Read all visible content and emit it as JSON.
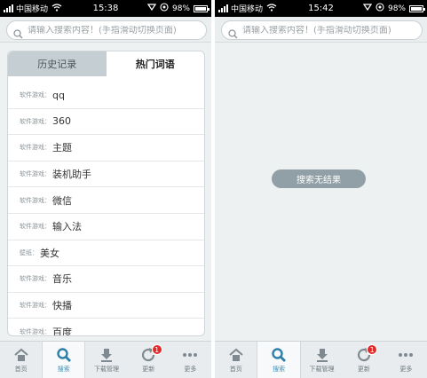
{
  "status_left": {
    "carrier": "中国移动",
    "time": "15:38",
    "battery": "98%"
  },
  "status_right": {
    "carrier": "中国移动",
    "time": "15:42",
    "battery": "98%"
  },
  "search": {
    "placeholder": "请输入搜索内容！(手指滑动切换页面)"
  },
  "tabs": {
    "history": "历史记录",
    "hot": "热门词语"
  },
  "hot_terms": [
    {
      "category": "软件游戏：",
      "term": "qq"
    },
    {
      "category": "软件游戏：",
      "term": "360"
    },
    {
      "category": "软件游戏：",
      "term": "主题"
    },
    {
      "category": "软件游戏：",
      "term": "装机助手"
    },
    {
      "category": "软件游戏：",
      "term": "微信"
    },
    {
      "category": "软件游戏：",
      "term": "输入法"
    },
    {
      "category": "壁纸：",
      "term": "美女"
    },
    {
      "category": "软件游戏：",
      "term": "音乐"
    },
    {
      "category": "软件游戏：",
      "term": "快播"
    },
    {
      "category": "软件游戏：",
      "term": "百度"
    }
  ],
  "empty_result": "搜索无结果",
  "tabbar": [
    {
      "label": "首页",
      "icon": "home-icon"
    },
    {
      "label": "搜索",
      "icon": "search-icon"
    },
    {
      "label": "下载管理",
      "icon": "download-icon"
    },
    {
      "label": "更新",
      "icon": "refresh-icon",
      "badge": "1"
    },
    {
      "label": "更多",
      "icon": "more-icon"
    }
  ],
  "colors": {
    "accent": "#3d8fb8",
    "badge": "#e02b2b",
    "tab_inactive": "#c4ced3"
  }
}
